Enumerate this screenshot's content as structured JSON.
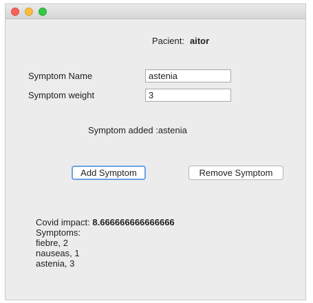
{
  "patient": {
    "label": "Pacient:",
    "name": "aitor"
  },
  "form": {
    "symptom_name_label": "Symptom Name",
    "symptom_name_value": "astenia",
    "symptom_weight_label": "Symptom weight",
    "symptom_weight_value": "3"
  },
  "status_text": "Symptom added :astenia",
  "buttons": {
    "add_label": "Add Symptom",
    "remove_label": "Remove Symptom"
  },
  "result": {
    "impact_label": "Covid impact: ",
    "impact_value": "8.666666666666666",
    "symptoms_label": "Symptoms:",
    "symptoms": [
      "fiebre, 2",
      "nauseas, 1",
      "astenia, 3"
    ]
  },
  "window_controls": {
    "close_color": "#fc605b",
    "minimize_color": "#fdbc40",
    "maximize_color": "#34c84a"
  },
  "accent_color": "#6aa0e4"
}
